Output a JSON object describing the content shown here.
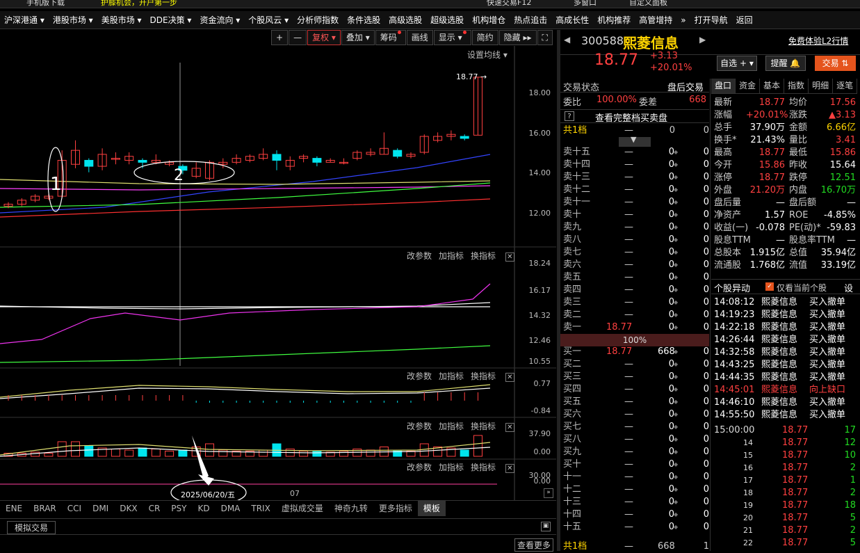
{
  "topbar": {
    "mobile_download": "手机版下载",
    "promo": "护膝机会，开户第一步",
    "fast_trade": "快速交易F12",
    "multi_window": "多窗口",
    "custom_panel": "自定义面板"
  },
  "menu": [
    "沪深港通 ▾",
    "港股市场 ▾",
    "美股市场 ▾",
    "DDE决策 ▾",
    "资金流向 ▾",
    "个股风云 ▾",
    "分析师指数",
    "条件选股",
    "高级选股",
    "超级选股",
    "机构增仓",
    "热点追击",
    "高成长性",
    "机构推荐",
    "高管增持",
    "»",
    "打开导航",
    "返回"
  ],
  "toolbar": {
    "plus": "+",
    "minus": "—",
    "fq": "复权 ▾",
    "overlay": "叠加 ▾",
    "chips": "筹码",
    "draw": "画线",
    "display": "显示 ▾",
    "simple": "简约",
    "hide": "隐藏 ▸▸",
    "full": "⛶"
  },
  "main_chart": {
    "settings": "设置均线 ▾",
    "price_label": "18.77",
    "ticks": [
      "18.00",
      "16.00",
      "14.00",
      "12.00"
    ],
    "annotation1": "1",
    "annotation2": "2"
  },
  "panel2": {
    "buttons": [
      "改参数",
      "加指标",
      "换指标"
    ],
    "ticks": [
      "18.24",
      "16.17",
      "14.32",
      "12.46",
      "10.55"
    ]
  },
  "panel3": {
    "buttons": [
      "改参数",
      "加指标",
      "换指标"
    ],
    "ticks": [
      "0.77",
      "-0.84"
    ]
  },
  "panel4": {
    "buttons": [
      "改参数",
      "加指标",
      "换指标"
    ],
    "ticks": [
      "37.90",
      "0.00"
    ]
  },
  "panel5": {
    "buttons": [
      "改参数",
      "加指标",
      "换指标"
    ],
    "ticks": [
      "30.00",
      "0.00"
    ]
  },
  "xaxis": {
    "date": "2025/06/20/五",
    "month": "07"
  },
  "indicator_tabs": [
    "ENE",
    "BRAR",
    "CCI",
    "DMI",
    "DKX",
    "CR",
    "PSY",
    "KD",
    "DMA",
    "TRIX",
    "虚拟成交量",
    "神奇九转",
    "更多指标",
    "模板"
  ],
  "sim_trade": "模拟交易",
  "view_more": "查看更多",
  "stock": {
    "code": "300588",
    "name": "熙菱信息",
    "price": "18.77",
    "change": "+3.13",
    "pct": "+20.01%",
    "l2": "免费体验L2行情"
  },
  "stock_buttons": {
    "watch": "自选 + ▾",
    "alert": "提醒 🔔",
    "trade": "交易 ⇅"
  },
  "trade_status": {
    "label": "交易状态",
    "after": "盘后交易",
    "wb_label": "委比",
    "wb_val": "100.00%",
    "wc_label": "委差",
    "wc_val": "668",
    "full_book": "查看完整档买卖盘",
    "total_label": "共1档",
    "total_dash": "—",
    "total_a": "0",
    "total_b": "0"
  },
  "sell_rows": [
    {
      "l": "卖十五",
      "p": "—",
      "v": "0",
      "n": "0"
    },
    {
      "l": "卖十四",
      "p": "—",
      "v": "0",
      "n": "0"
    },
    {
      "l": "卖十三",
      "p": "—",
      "v": "0",
      "n": "0"
    },
    {
      "l": "卖十二",
      "p": "—",
      "v": "0",
      "n": "0"
    },
    {
      "l": "卖十一",
      "p": "—",
      "v": "0",
      "n": "0"
    },
    {
      "l": "卖十",
      "p": "—",
      "v": "0",
      "n": "0"
    },
    {
      "l": "卖九",
      "p": "—",
      "v": "0",
      "n": "0"
    },
    {
      "l": "卖八",
      "p": "—",
      "v": "0",
      "n": "0"
    },
    {
      "l": "卖七",
      "p": "—",
      "v": "0",
      "n": "0"
    },
    {
      "l": "卖六",
      "p": "—",
      "v": "0",
      "n": "0"
    },
    {
      "l": "卖五",
      "p": "—",
      "v": "0",
      "n": "0"
    },
    {
      "l": "卖四",
      "p": "—",
      "v": "0",
      "n": "0"
    },
    {
      "l": "卖三",
      "p": "—",
      "v": "0",
      "n": "0"
    },
    {
      "l": "卖二",
      "p": "—",
      "v": "0",
      "n": "0"
    },
    {
      "l": "卖一",
      "p": "18.77",
      "v": "0",
      "n": "0"
    }
  ],
  "mid_pct": "100%",
  "buy_rows": [
    {
      "l": "买一",
      "p": "18.77",
      "v": "668",
      "n": "0"
    },
    {
      "l": "买二",
      "p": "—",
      "v": "0",
      "n": "0"
    },
    {
      "l": "买三",
      "p": "—",
      "v": "0",
      "n": "0"
    },
    {
      "l": "买四",
      "p": "—",
      "v": "0",
      "n": "0"
    },
    {
      "l": "买五",
      "p": "—",
      "v": "0",
      "n": "0"
    },
    {
      "l": "买六",
      "p": "—",
      "v": "0",
      "n": "0"
    },
    {
      "l": "买七",
      "p": "—",
      "v": "0",
      "n": "0"
    },
    {
      "l": "买八",
      "p": "—",
      "v": "0",
      "n": "0"
    },
    {
      "l": "买九",
      "p": "—",
      "v": "0",
      "n": "0"
    },
    {
      "l": "买十",
      "p": "—",
      "v": "0",
      "n": "0"
    },
    {
      "l": "十一",
      "p": "—",
      "v": "0",
      "n": "0"
    },
    {
      "l": "十二",
      "p": "—",
      "v": "0",
      "n": "0"
    },
    {
      "l": "十三",
      "p": "—",
      "v": "0",
      "n": "0"
    },
    {
      "l": "十四",
      "p": "—",
      "v": "0",
      "n": "0"
    },
    {
      "l": "十五",
      "p": "—",
      "v": "0",
      "n": "0"
    }
  ],
  "buy_total": {
    "l": "共1档",
    "p": "—",
    "v": "668",
    "n": "1"
  },
  "right_tabs": [
    "盘口",
    "资金",
    "基本",
    "指数",
    "明细",
    "逐笔"
  ],
  "quote_info": [
    {
      "a": "最新",
      "av": "18.77",
      "ac": "red",
      "b": "均价",
      "bv": "17.56",
      "bc": "red"
    },
    {
      "a": "涨幅",
      "av": "+20.01%",
      "ac": "red",
      "b": "涨跌",
      "bv": "▲3.13",
      "bc": "red"
    },
    {
      "a": "总手",
      "av": "37.90万",
      "ac": "wht",
      "b": "金额",
      "bv": "6.66亿",
      "bc": "yel"
    },
    {
      "a": "换手*",
      "av": "21.43%",
      "ac": "wht",
      "b": "量比",
      "bv": "3.41",
      "bc": "red"
    },
    {
      "a": "最高",
      "av": "18.77",
      "ac": "red",
      "b": "最低",
      "bv": "15.86",
      "bc": "red"
    },
    {
      "a": "今开",
      "av": "15.86",
      "ac": "red",
      "b": "昨收",
      "bv": "15.64",
      "bc": "wht"
    },
    {
      "a": "涨停",
      "av": "18.77",
      "ac": "red",
      "b": "跌停",
      "bv": "12.51",
      "bc": "grn"
    },
    {
      "a": "外盘",
      "av": "21.20万",
      "ac": "red",
      "b": "内盘",
      "bv": "16.70万",
      "bc": "grn"
    },
    {
      "a": "盘后量",
      "av": "—",
      "ac": "wht",
      "b": "盘后额",
      "bv": "—",
      "bc": "wht"
    },
    {
      "a": "净资产",
      "av": "1.57",
      "ac": "wht",
      "b": "ROE",
      "bv": "-4.85%",
      "bc": "wht"
    },
    {
      "a": "收益(一)",
      "av": "-0.078",
      "ac": "wht",
      "b": "PE(动)*",
      "bv": "-59.83",
      "bc": "wht"
    },
    {
      "a": "股息TTM",
      "av": "—",
      "ac": "wht",
      "b": "股息率TTM",
      "bv": "—",
      "bc": "wht"
    },
    {
      "a": "总股本",
      "av": "1.915亿",
      "ac": "wht",
      "b": "总值",
      "bv": "35.94亿",
      "bc": "wht"
    },
    {
      "a": "流通股",
      "av": "1.768亿",
      "ac": "wht",
      "b": "流值",
      "bv": "33.19亿",
      "bc": "wht"
    }
  ],
  "movers": {
    "title": "个股异动",
    "only_current": "仅看当前个股",
    "settings": "设",
    "rows": [
      {
        "t": "14:08:12",
        "n": "熙菱信息",
        "e": "买入撤单",
        "hl": false
      },
      {
        "t": "14:19:23",
        "n": "熙菱信息",
        "e": "买入撤单",
        "hl": false
      },
      {
        "t": "14:22:18",
        "n": "熙菱信息",
        "e": "买入撤单",
        "hl": false
      },
      {
        "t": "14:26:44",
        "n": "熙菱信息",
        "e": "买入撤单",
        "hl": false
      },
      {
        "t": "14:32:58",
        "n": "熙菱信息",
        "e": "买入撤单",
        "hl": false
      },
      {
        "t": "14:43:25",
        "n": "熙菱信息",
        "e": "买入撤单",
        "hl": false
      },
      {
        "t": "14:44:35",
        "n": "熙菱信息",
        "e": "买入撤单",
        "hl": false
      },
      {
        "t": "14:45:01",
        "n": "熙菱信息",
        "e": "向上缺口",
        "hl": true
      },
      {
        "t": "14:46:10",
        "n": "熙菱信息",
        "e": "买入撤单",
        "hl": false
      },
      {
        "t": "14:55:50",
        "n": "熙菱信息",
        "e": "买入撤单",
        "hl": false
      }
    ]
  },
  "ticks": [
    {
      "t": "15:00:00",
      "p": "18.77",
      "v": "17"
    },
    {
      "t": "14",
      "p": "18.77",
      "v": "12"
    },
    {
      "t": "15",
      "p": "18.77",
      "v": "10"
    },
    {
      "t": "16",
      "p": "18.77",
      "v": "2"
    },
    {
      "t": "17",
      "p": "18.77",
      "v": "1"
    },
    {
      "t": "18",
      "p": "18.77",
      "v": "2"
    },
    {
      "t": "19",
      "p": "18.77",
      "v": "18"
    },
    {
      "t": "20",
      "p": "18.77",
      "v": "5"
    },
    {
      "t": "21",
      "p": "18.77",
      "v": "2"
    },
    {
      "t": "22",
      "p": "18.77",
      "v": "5"
    }
  ],
  "colors": {
    "up": "#ff4040",
    "down": "#00e5ee",
    "ma_blue": "#3344ff",
    "ma_yellow": "#e0e070",
    "ma_red": "#ff3030",
    "ma_mag": "#ff40ff",
    "ma_green": "#40ff40"
  },
  "candles": [
    {
      "o": 12.3,
      "c": 12.4,
      "h": 12.5,
      "l": 12.2
    },
    {
      "o": 12.4,
      "c": 12.6,
      "h": 12.7,
      "l": 12.3
    },
    {
      "o": 12.6,
      "c": 12.8,
      "h": 12.9,
      "l": 12.5
    },
    {
      "o": 12.7,
      "c": 12.8,
      "h": 12.9,
      "l": 12.6
    },
    {
      "o": 12.8,
      "c": 14.6,
      "h": 15.1,
      "l": 12.7
    },
    {
      "o": 14.4,
      "c": 15.1,
      "h": 15.6,
      "l": 14.2
    },
    {
      "o": 14.6,
      "c": 14.3,
      "h": 14.7,
      "l": 14.0
    },
    {
      "o": 14.3,
      "c": 14.9,
      "h": 15.2,
      "l": 14.1
    },
    {
      "o": 14.7,
      "c": 14.7,
      "h": 15.0,
      "l": 14.4
    },
    {
      "o": 14.6,
      "c": 14.8,
      "h": 15.0,
      "l": 14.4
    },
    {
      "o": 14.6,
      "c": 14.5,
      "h": 14.7,
      "l": 14.2
    },
    {
      "o": 14.5,
      "c": 14.6,
      "h": 14.9,
      "l": 14.4
    },
    {
      "o": 14.4,
      "c": 14.5,
      "h": 14.6,
      "l": 14.3
    },
    {
      "o": 14.3,
      "c": 14.1,
      "h": 14.4,
      "l": 13.9
    },
    {
      "o": 13.8,
      "c": 14.2,
      "h": 14.5,
      "l": 13.7
    },
    {
      "o": 13.7,
      "c": 14.5,
      "h": 14.6,
      "l": 13.6
    },
    {
      "o": 14.4,
      "c": 14.5,
      "h": 14.7,
      "l": 14.2
    },
    {
      "o": 14.5,
      "c": 14.7,
      "h": 14.9,
      "l": 14.4
    },
    {
      "o": 14.6,
      "c": 14.8,
      "h": 14.9,
      "l": 14.5
    },
    {
      "o": 14.7,
      "c": 14.9,
      "h": 15.2,
      "l": 14.6
    },
    {
      "o": 14.9,
      "c": 14.6,
      "h": 15.1,
      "l": 14.1
    },
    {
      "o": 14.3,
      "c": 14.6,
      "h": 14.8,
      "l": 14.1
    },
    {
      "o": 14.7,
      "c": 14.8,
      "h": 14.9,
      "l": 14.5
    },
    {
      "o": 14.7,
      "c": 14.5,
      "h": 14.8,
      "l": 14.3
    },
    {
      "o": 14.5,
      "c": 14.6,
      "h": 14.7,
      "l": 14.5
    },
    {
      "o": 14.5,
      "c": 14.5,
      "h": 14.7,
      "l": 14.4
    },
    {
      "o": 14.7,
      "c": 15.0,
      "h": 15.1,
      "l": 14.6
    },
    {
      "o": 14.9,
      "c": 15.0,
      "h": 15.2,
      "l": 14.8
    },
    {
      "o": 14.9,
      "c": 15.2,
      "h": 16.0,
      "l": 14.9
    },
    {
      "o": 15.1,
      "c": 14.8,
      "h": 15.2,
      "l": 14.7
    },
    {
      "o": 14.8,
      "c": 14.9,
      "h": 15.0,
      "l": 14.7
    },
    {
      "o": 15.0,
      "c": 15.8,
      "h": 15.9,
      "l": 14.9
    },
    {
      "o": 15.6,
      "c": 15.8,
      "h": 16.0,
      "l": 15.5
    },
    {
      "o": 15.8,
      "c": 15.9,
      "h": 16.1,
      "l": 15.6
    },
    {
      "o": 15.8,
      "c": 15.7,
      "h": 15.9,
      "l": 15.6
    },
    {
      "o": 15.86,
      "c": 18.77,
      "h": 18.77,
      "l": 15.86
    }
  ]
}
